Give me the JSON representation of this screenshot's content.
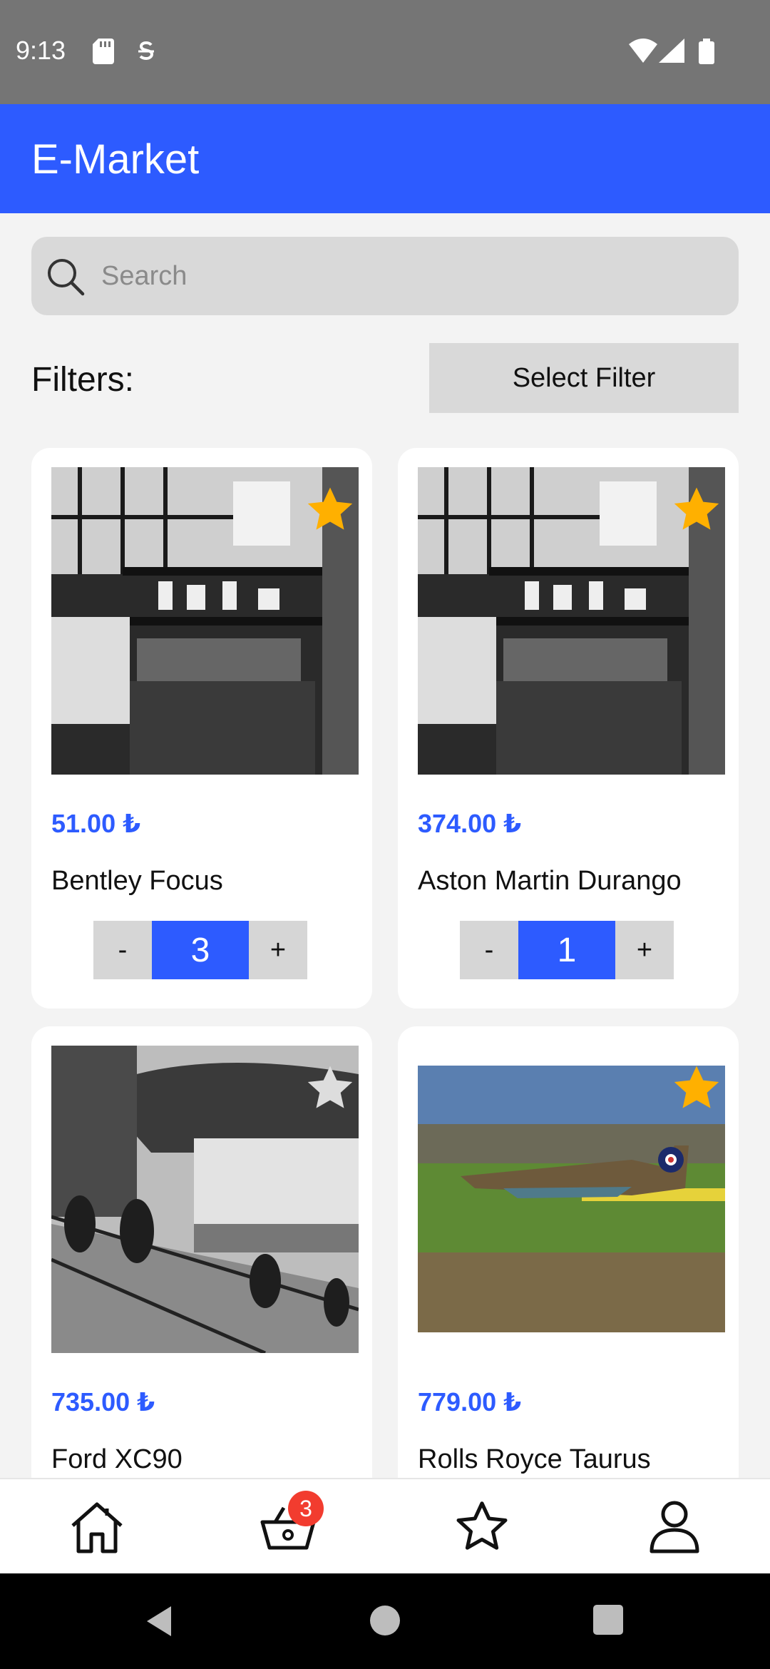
{
  "status_bar": {
    "time": "9:13",
    "icons": [
      "sd-card-icon",
      "s-badge-icon",
      "wifi-icon",
      "cell-signal-icon",
      "battery-icon"
    ]
  },
  "app_bar": {
    "title": "E-Market"
  },
  "search": {
    "placeholder": "Search",
    "value": ""
  },
  "filters": {
    "label": "Filters:",
    "button_label": "Select Filter"
  },
  "products": [
    {
      "price": "51.00 ₺",
      "name": "Bentley Focus",
      "quantity": "3",
      "favorite": true,
      "image": "shop-counter-photo"
    },
    {
      "price": "374.00 ₺",
      "name": "Aston Martin Durango",
      "quantity": "1",
      "favorite": true,
      "image": "shop-counter-photo"
    },
    {
      "price": "735.00 ₺",
      "name": "Ford XC90",
      "quantity": "",
      "favorite": false,
      "image": "temple-stairs-photo"
    },
    {
      "price": "779.00 ₺",
      "name": "Rolls Royce Taurus",
      "quantity": "",
      "favorite": true,
      "image": "airplane-photo"
    }
  ],
  "qty_controls": {
    "minus": "-",
    "plus": "+"
  },
  "bottom_nav": {
    "items": [
      {
        "icon": "home-icon"
      },
      {
        "icon": "basket-icon",
        "badge": "3"
      },
      {
        "icon": "star-outline-icon"
      },
      {
        "icon": "profile-icon"
      }
    ]
  },
  "colors": {
    "primary": "#2d5bff",
    "status_bar": "#757575",
    "star_active": "#ffb000",
    "star_inactive": "#dddddd",
    "badge": "#f23c2f"
  }
}
